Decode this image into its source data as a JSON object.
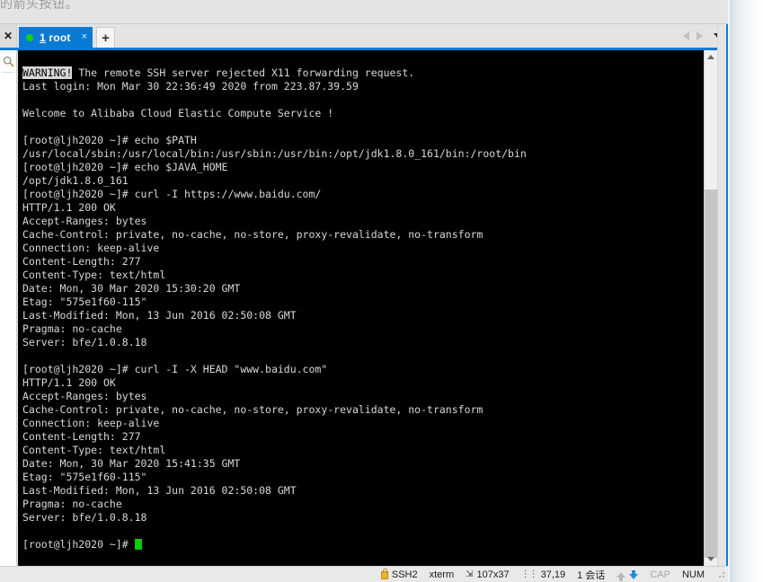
{
  "banner": {
    "text": "的箭头按钮。"
  },
  "tabbar": {
    "close_all_label": "✕",
    "new_tab_label": "+",
    "tabs": [
      {
        "index": "1",
        "title": "root",
        "close_label": "×",
        "status_dot_color": "#16d016"
      }
    ],
    "nav_prev_name": "previous-tab",
    "nav_next_name": "next-tab",
    "nav_list_name": "tab-list-dropdown"
  },
  "left_rail": {
    "close_label": "✕",
    "search_label": "🔍"
  },
  "terminal": {
    "prompt": "[root@ljh2020 ~]#",
    "warning_tag": "WARNING!",
    "lines": [
      {
        "type": "warning",
        "tag": "WARNING!",
        "text": " The remote SSH server rejected X11 forwarding request."
      },
      {
        "type": "text",
        "text": "Last login: Mon Mar 30 22:36:49 2020 from 223.87.39.59"
      },
      {
        "type": "blank",
        "text": ""
      },
      {
        "type": "text",
        "text": "Welcome to Alibaba Cloud Elastic Compute Service !"
      },
      {
        "type": "blank",
        "text": ""
      },
      {
        "type": "text",
        "text": "[root@ljh2020 ~]# echo $PATH"
      },
      {
        "type": "text",
        "text": "/usr/local/sbin:/usr/local/bin:/usr/sbin:/usr/bin:/opt/jdk1.8.0_161/bin:/root/bin"
      },
      {
        "type": "text",
        "text": "[root@ljh2020 ~]# echo $JAVA_HOME"
      },
      {
        "type": "text",
        "text": "/opt/jdk1.8.0_161"
      },
      {
        "type": "text",
        "text": "[root@ljh2020 ~]# curl -I https://www.baidu.com/"
      },
      {
        "type": "text",
        "text": "HTTP/1.1 200 OK"
      },
      {
        "type": "text",
        "text": "Accept-Ranges: bytes"
      },
      {
        "type": "text",
        "text": "Cache-Control: private, no-cache, no-store, proxy-revalidate, no-transform"
      },
      {
        "type": "text",
        "text": "Connection: keep-alive"
      },
      {
        "type": "text",
        "text": "Content-Length: 277"
      },
      {
        "type": "text",
        "text": "Content-Type: text/html"
      },
      {
        "type": "text",
        "text": "Date: Mon, 30 Mar 2020 15:30:20 GMT"
      },
      {
        "type": "text",
        "text": "Etag: \"575e1f60-115\""
      },
      {
        "type": "text",
        "text": "Last-Modified: Mon, 13 Jun 2016 02:50:08 GMT"
      },
      {
        "type": "text",
        "text": "Pragma: no-cache"
      },
      {
        "type": "text",
        "text": "Server: bfe/1.0.8.18"
      },
      {
        "type": "blank",
        "text": ""
      },
      {
        "type": "text",
        "text": "[root@ljh2020 ~]# curl -I -X HEAD \"www.baidu.com\""
      },
      {
        "type": "text",
        "text": "HTTP/1.1 200 OK"
      },
      {
        "type": "text",
        "text": "Accept-Ranges: bytes"
      },
      {
        "type": "text",
        "text": "Cache-Control: private, no-cache, no-store, proxy-revalidate, no-transform"
      },
      {
        "type": "text",
        "text": "Connection: keep-alive"
      },
      {
        "type": "text",
        "text": "Content-Length: 277"
      },
      {
        "type": "text",
        "text": "Content-Type: text/html"
      },
      {
        "type": "text",
        "text": "Date: Mon, 30 Mar 2020 15:41:35 GMT"
      },
      {
        "type": "text",
        "text": "Etag: \"575e1f60-115\""
      },
      {
        "type": "text",
        "text": "Last-Modified: Mon, 13 Jun 2016 02:50:08 GMT"
      },
      {
        "type": "text",
        "text": "Pragma: no-cache"
      },
      {
        "type": "text",
        "text": "Server: bfe/1.0.8.18"
      },
      {
        "type": "blank",
        "text": ""
      },
      {
        "type": "prompt",
        "text": "[root@ljh2020 ~]# "
      }
    ],
    "colors": {
      "background": "#000000",
      "foreground": "#d8d8d8",
      "cursor": "#00d000"
    }
  },
  "statusbar": {
    "protocol": "SSH2",
    "emulation": "xterm",
    "size": "107x37",
    "cursor_pos": "37,19",
    "sessions": "1 会话",
    "cap_label": "CAP",
    "num_label": "NUM",
    "cap_active": false,
    "num_active": true
  }
}
